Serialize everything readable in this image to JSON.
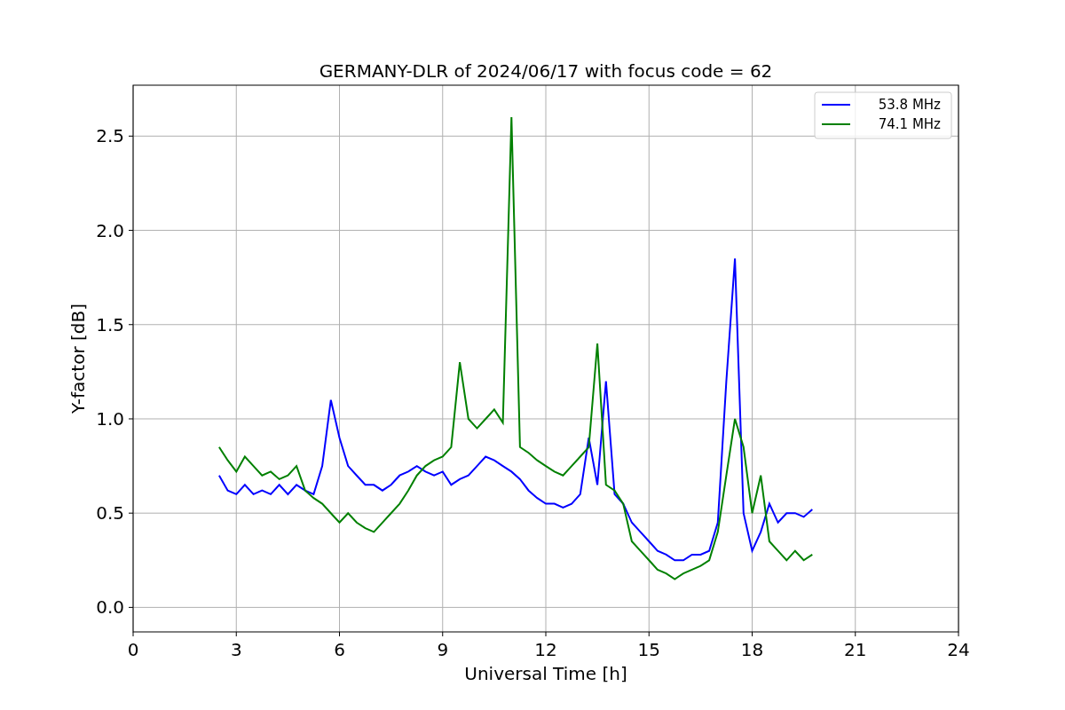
{
  "chart_data": {
    "type": "line",
    "grid": true,
    "legend": "upper right",
    "title": "GERMANY-DLR of 2024/06/17 with focus code = 62",
    "xlabel": "Universal Time [h]",
    "ylabel": "Y-factor [dB]",
    "x": [
      2.5,
      2.75,
      3,
      3.25,
      3.5,
      3.75,
      4,
      4.25,
      4.5,
      4.75,
      5,
      5.25,
      5.5,
      5.75,
      6,
      6.25,
      6.5,
      6.75,
      7,
      7.25,
      7.5,
      7.75,
      8,
      8.25,
      8.5,
      8.75,
      9,
      9.25,
      9.5,
      9.75,
      10,
      10.25,
      10.5,
      10.75,
      11,
      11.25,
      11.5,
      11.75,
      12,
      12.25,
      12.5,
      12.75,
      13,
      13.25,
      13.5,
      13.75,
      14,
      14.25,
      14.5,
      14.75,
      15,
      15.25,
      15.5,
      15.75,
      16,
      16.25,
      16.5,
      16.75,
      17,
      17.25,
      17.5,
      17.75,
      18,
      18.25,
      18.5,
      18.75,
      19,
      19.25,
      19.5,
      19.75
    ],
    "series": [
      {
        "name": "53.8 MHz",
        "color": "#0000ff",
        "values": [
          0.7,
          0.62,
          0.6,
          0.65,
          0.6,
          0.62,
          0.6,
          0.65,
          0.6,
          0.65,
          0.62,
          0.6,
          0.75,
          1.1,
          0.9,
          0.75,
          0.7,
          0.65,
          0.65,
          0.62,
          0.65,
          0.7,
          0.72,
          0.75,
          0.72,
          0.7,
          0.72,
          0.65,
          0.68,
          0.7,
          0.75,
          0.8,
          0.78,
          0.75,
          0.72,
          0.68,
          0.62,
          0.58,
          0.55,
          0.55,
          0.53,
          0.55,
          0.6,
          0.9,
          0.65,
          1.2,
          0.6,
          0.55,
          0.45,
          0.4,
          0.35,
          0.3,
          0.28,
          0.25,
          0.25,
          0.28,
          0.28,
          0.3,
          0.45,
          1.2,
          1.85,
          0.5,
          0.3,
          0.4,
          0.55,
          0.45,
          0.5,
          0.5,
          0.48,
          0.52
        ]
      },
      {
        "name": "74.1 MHz",
        "color": "#008000",
        "values": [
          0.85,
          0.78,
          0.72,
          0.8,
          0.75,
          0.7,
          0.72,
          0.68,
          0.7,
          0.75,
          0.62,
          0.58,
          0.55,
          0.5,
          0.45,
          0.5,
          0.45,
          0.42,
          0.4,
          0.45,
          0.5,
          0.55,
          0.62,
          0.7,
          0.75,
          0.78,
          0.8,
          0.85,
          1.3,
          1.0,
          0.95,
          1.0,
          1.05,
          0.98,
          2.6,
          0.85,
          0.82,
          0.78,
          0.75,
          0.72,
          0.7,
          0.75,
          0.8,
          0.85,
          1.4,
          0.65,
          0.62,
          0.55,
          0.35,
          0.3,
          0.25,
          0.2,
          0.18,
          0.15,
          0.18,
          0.2,
          0.22,
          0.25,
          0.4,
          0.7,
          1.0,
          0.85,
          0.5,
          0.7,
          0.35,
          0.3,
          0.25,
          0.3,
          0.25,
          0.28
        ]
      }
    ],
    "xlim": [
      0,
      24
    ],
    "ylim": [
      -0.13,
      2.77
    ],
    "xticks": [
      0,
      3,
      6,
      9,
      12,
      15,
      18,
      21,
      24
    ],
    "yticks": [
      {
        "value": 0,
        "label": "0.0"
      },
      {
        "value": 0.5,
        "label": "0.5"
      },
      {
        "value": 1,
        "label": "1.0"
      },
      {
        "value": 1.5,
        "label": "1.5"
      },
      {
        "value": 2,
        "label": "2.0"
      },
      {
        "value": 2.5,
        "label": "2.5"
      }
    ]
  }
}
